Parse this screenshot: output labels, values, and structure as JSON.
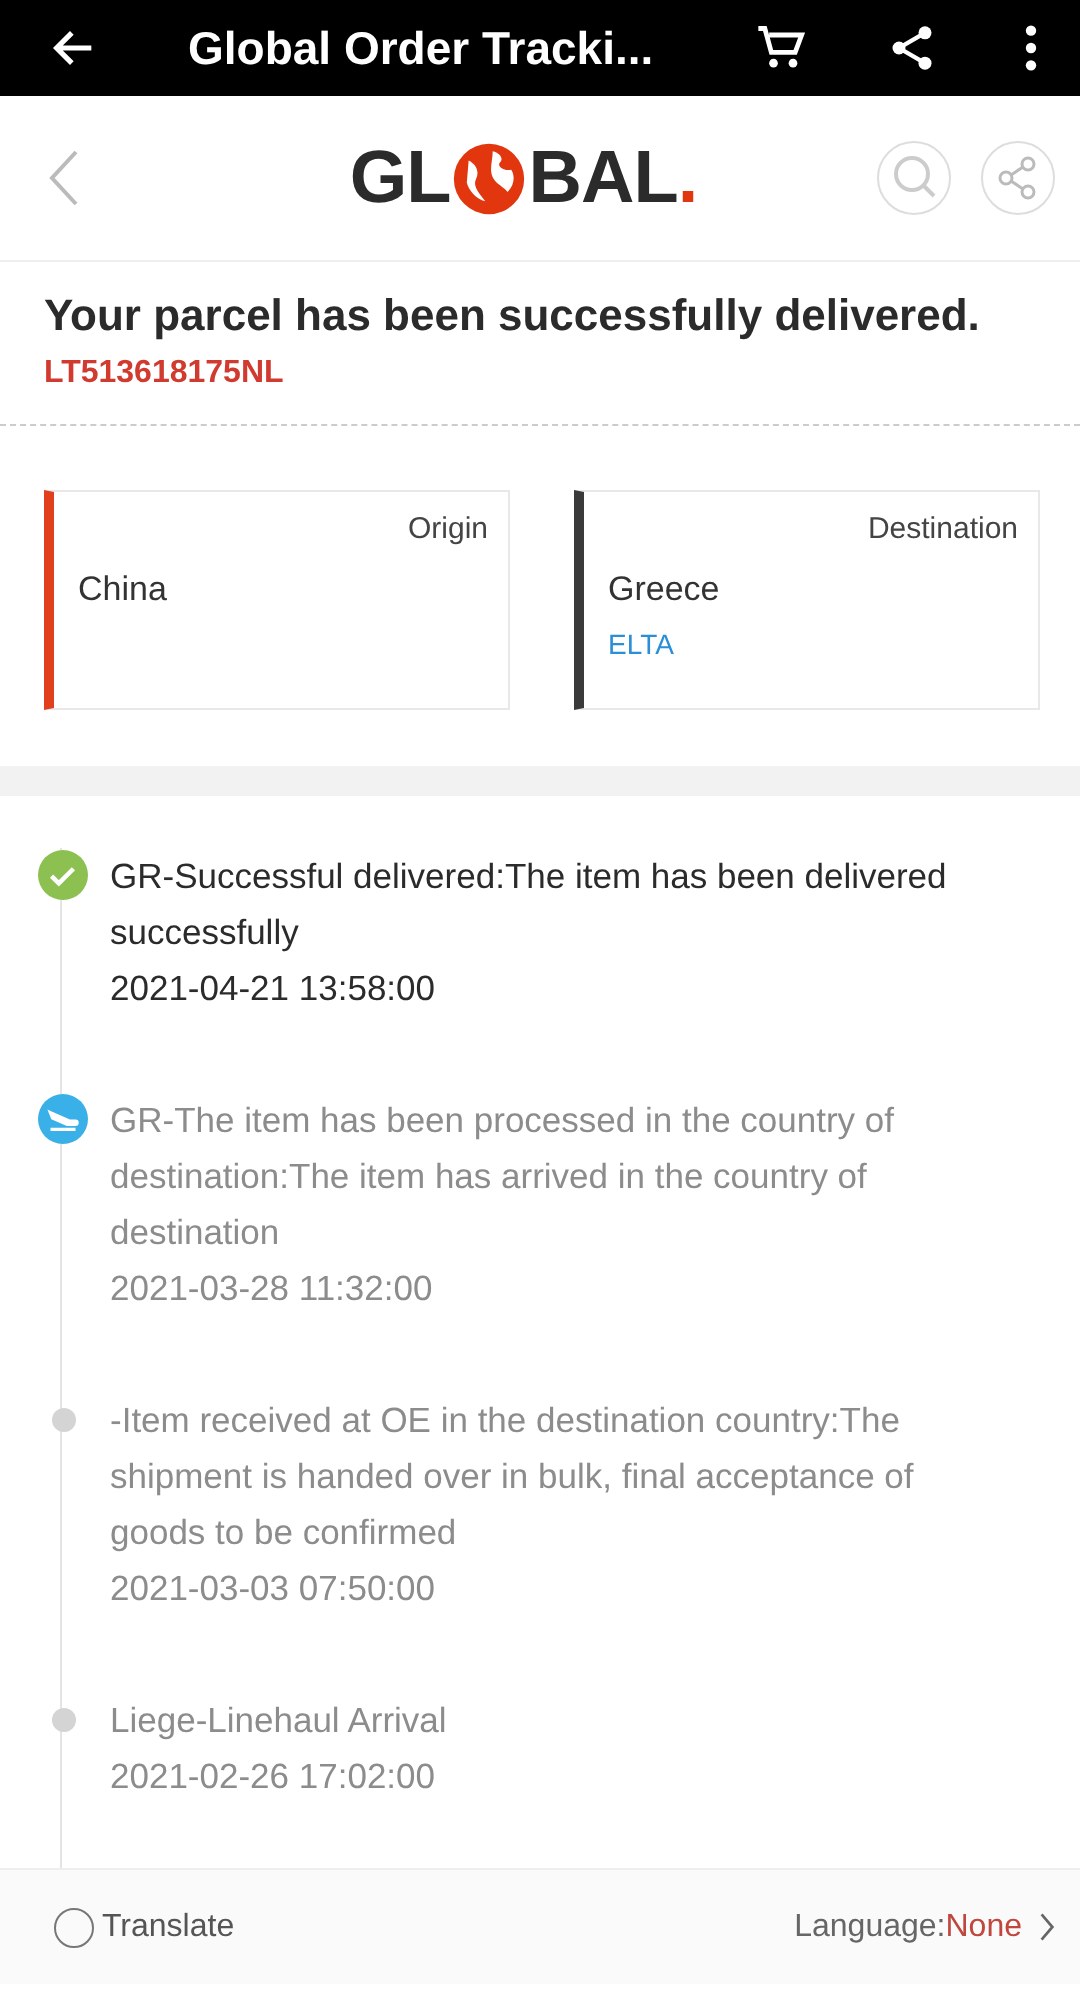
{
  "app_bar": {
    "title": "Global Order Tracki..."
  },
  "header": {
    "logo_left": "GL",
    "logo_right": "BAL",
    "logo_dot": "."
  },
  "status": {
    "headline": "Your parcel has been successfully delivered.",
    "tracking_number": "LT513618175NL"
  },
  "route": [
    {
      "label": "Origin",
      "country": "China",
      "color": "#e0401e"
    },
    {
      "label": "Destination",
      "country": "Greece",
      "carrier": "ELTA",
      "color": "#3a3a3a"
    }
  ],
  "events": [
    {
      "kind": "delivered",
      "current": true,
      "text": "GR-Successful delivered:The item has been delivered successfully",
      "time": "2021-04-21 13:58:00"
    },
    {
      "kind": "flight",
      "current": false,
      "text": "GR-The item has been processed in the country of destination:The item has arrived in the country of destination",
      "time": "2021-03-28 11:32:00"
    },
    {
      "kind": "dot",
      "current": false,
      "text": "-Item received at OE in the destination country:The shipment is handed over in bulk, final acceptance of goods to be confirmed",
      "time": "2021-03-03 07:50:00"
    },
    {
      "kind": "dot",
      "current": false,
      "text": "Liege-Linehaul Arrival",
      "time": "2021-02-26 17:02:00"
    }
  ],
  "translate_bar": {
    "label": "Translate",
    "checked": false,
    "language_label": "Language:",
    "language_value": "None"
  }
}
